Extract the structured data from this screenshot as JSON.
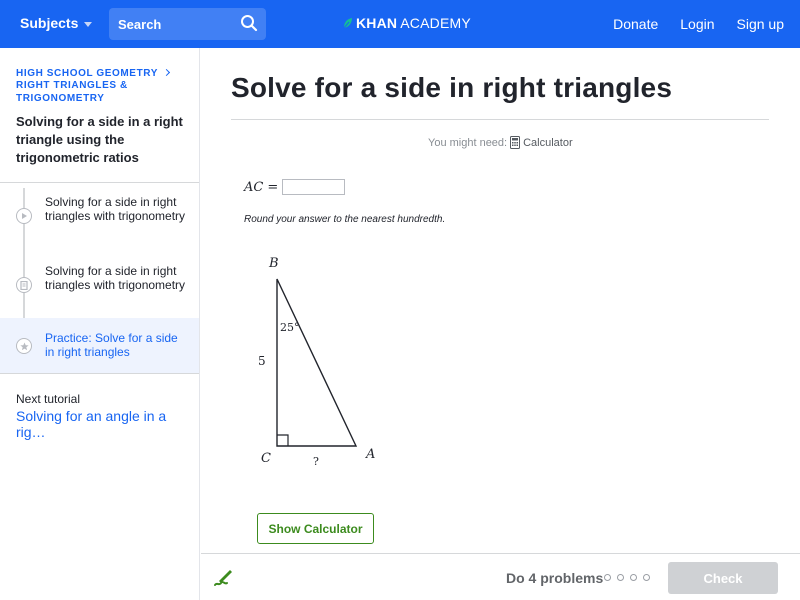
{
  "header": {
    "subjects_label": "Subjects",
    "search_placeholder": "Search",
    "logo_khan": "KHAN",
    "logo_academy": "ACADEMY",
    "nav": {
      "donate": "Donate",
      "login": "Login",
      "signup": "Sign up"
    },
    "brand_color": "#1865f2"
  },
  "sidebar": {
    "breadcrumb": {
      "course": "High school geometry",
      "unit": "Right triangles & trigonometry"
    },
    "tutorial_title": "Solving for a side in a right triangle using the trigonometric ratios",
    "items": [
      {
        "label": "Solving for a side in right triangles with trigonometry",
        "icon": "play-icon",
        "active": false
      },
      {
        "label": "Solving for a side in right triangles with trigonometry",
        "icon": "article-icon",
        "active": false
      },
      {
        "label": "Practice: Solve for a side in right triangles",
        "icon": "star-icon",
        "active": true
      }
    ],
    "next": {
      "label": "Next tutorial",
      "link": "Solving for an angle in a rig…"
    }
  },
  "main": {
    "title": "Solve for a side in right triangles",
    "might_need": "You might need:",
    "calculator_label": "Calculator",
    "equation": {
      "lhs": "AC",
      "eq": "="
    },
    "answer_value": "",
    "instruction": "Round your answer to the nearest hundredth.",
    "diagram": {
      "vertex_b": "B",
      "vertex_c": "C",
      "vertex_a": "A",
      "angle_label": "25°",
      "side_bc": "5",
      "side_ca": "?"
    },
    "show_calculator": "Show Calculator"
  },
  "footer": {
    "do_problems": "Do 4 problems",
    "progress_dots": 4,
    "check_label": "Check",
    "accent_green": "#3c8b1e"
  }
}
